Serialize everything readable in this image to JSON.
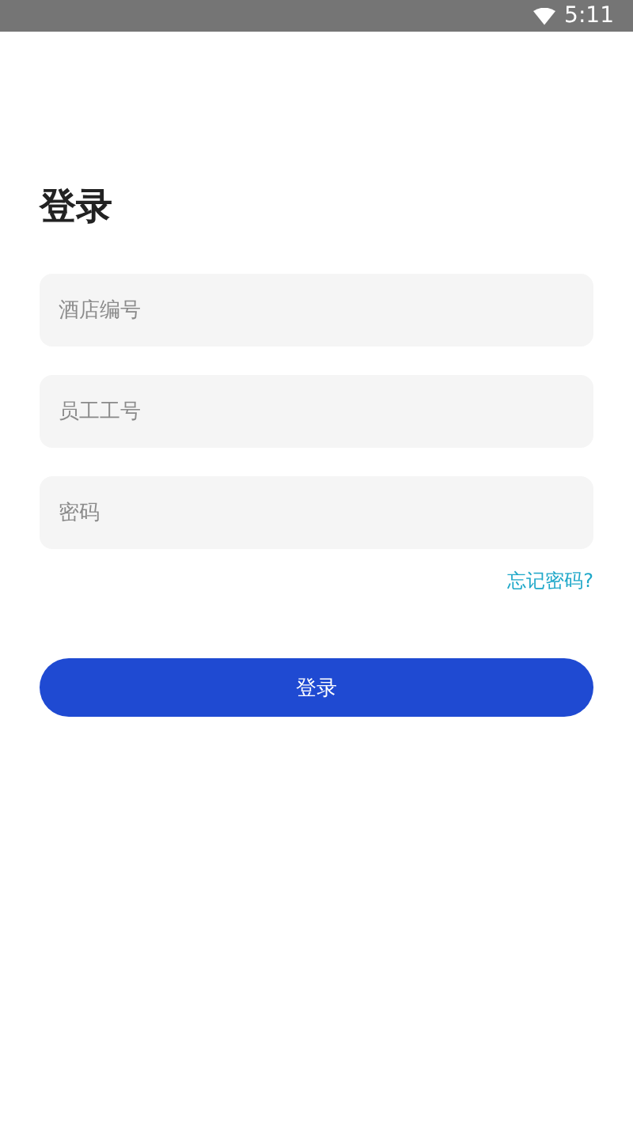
{
  "status_bar": {
    "time": "5:11"
  },
  "title": "登录",
  "fields": [
    {
      "placeholder": "酒店编号"
    },
    {
      "placeholder": "员工工号"
    },
    {
      "placeholder": "密码"
    }
  ],
  "forgot_link": "忘记密码?",
  "login_button": "登录"
}
